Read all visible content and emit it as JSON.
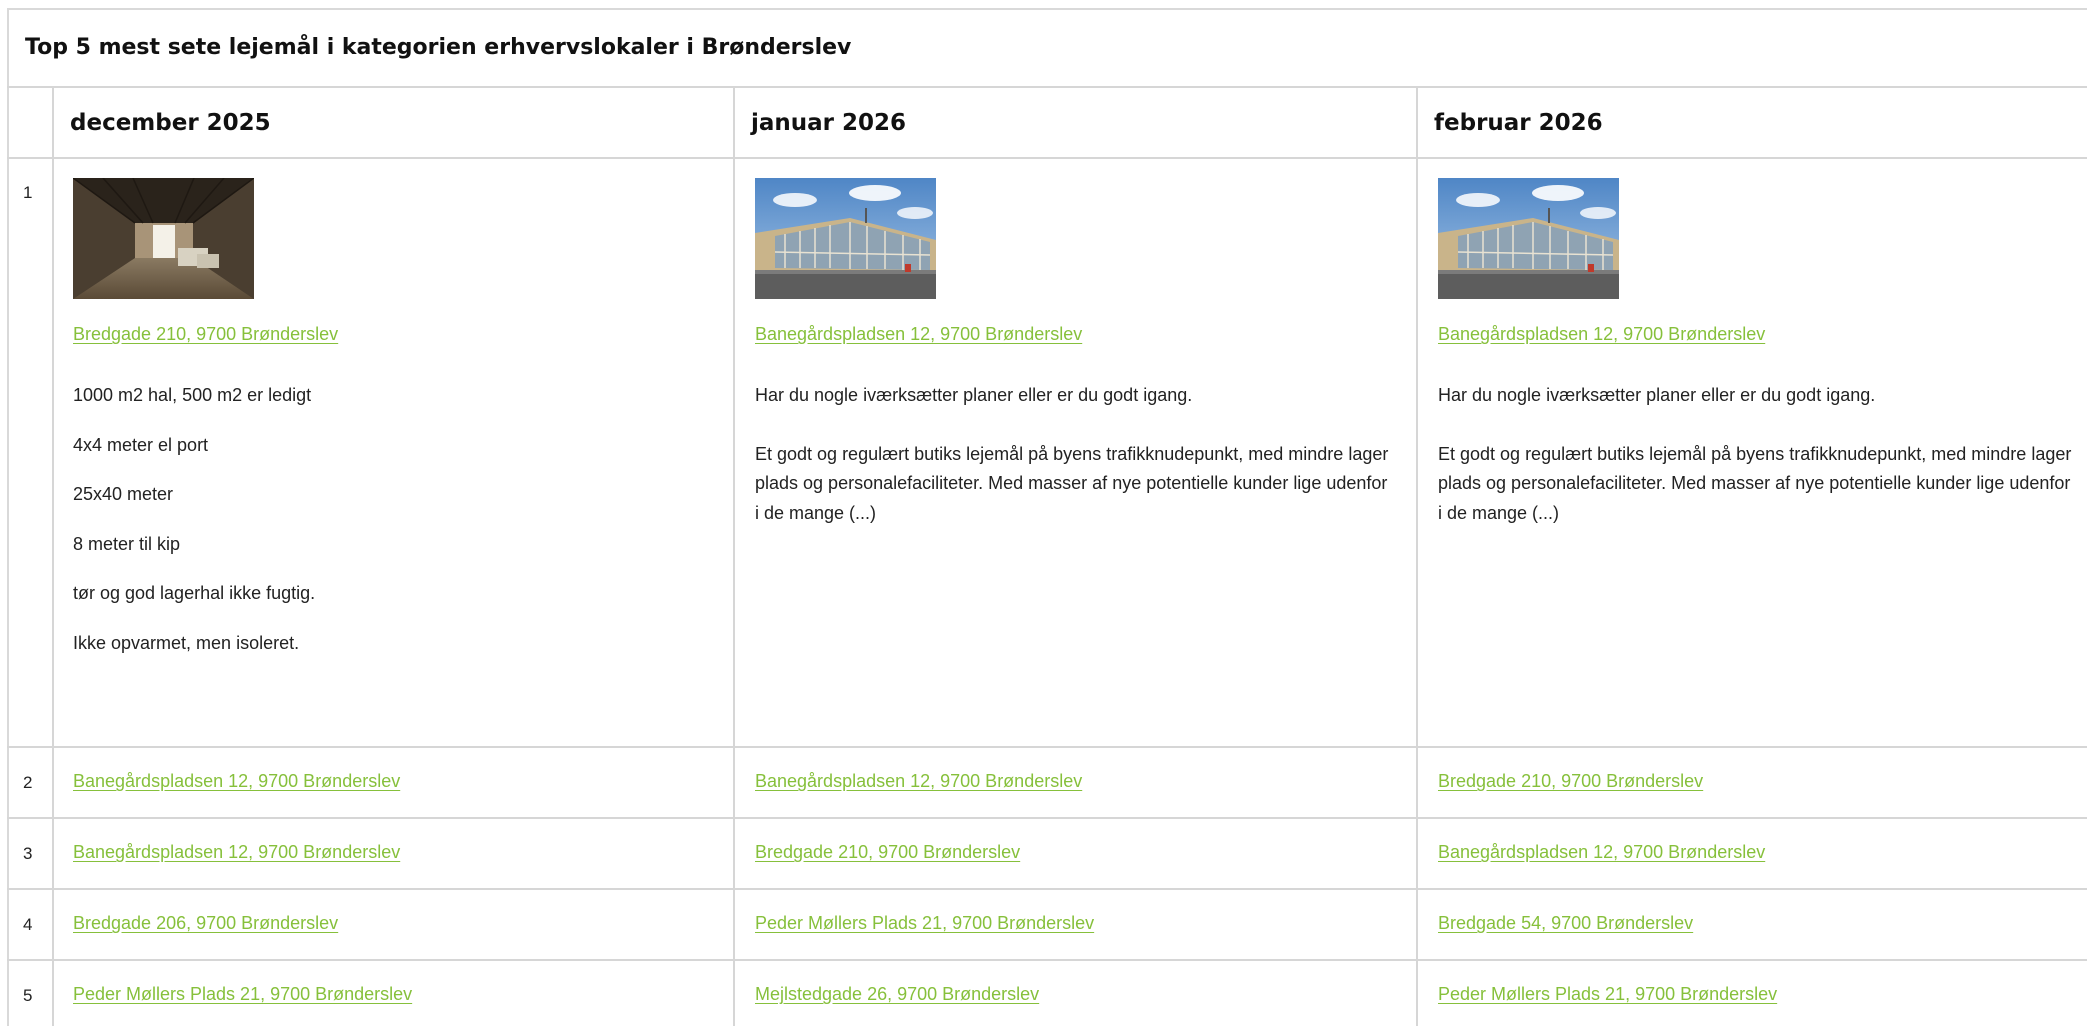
{
  "title": "Top 5 mest sete lejemål i kategorien erhvervslokaler i Brønderslev",
  "columns": [
    {
      "month": "december 2025"
    },
    {
      "month": "januar 2026"
    },
    {
      "month": "februar 2026"
    }
  ],
  "ranks": [
    "1",
    "2",
    "3",
    "4",
    "5"
  ],
  "top": [
    {
      "image": "warehouse-hall-photo",
      "address": "Bredgade 210, 9700 Brønderslev",
      "lines": [
        "1000 m2 hal, 500 m2 er ledigt",
        "4x4 meter el port",
        "25x40 meter",
        "8 meter til kip",
        "tør og god lagerhal ikke fugtig.",
        "Ikke opvarmet, men isoleret."
      ]
    },
    {
      "image": "station-building-photo",
      "address": "Banegårdspladsen 12, 9700 Brønderslev",
      "intro": "Har du nogle iværksætter planer eller er du godt igang.",
      "body": "Et godt og regulært butiks lejemål på byens trafikknudepunkt, med mindre lager plads og personalefaciliteter. Med masser af nye potentielle kunder lige udenfor i de mange (...)"
    },
    {
      "image": "station-building-photo",
      "address": "Banegårdspladsen 12, 9700 Brønderslev",
      "intro": "Har du nogle iværksætter planer eller er du godt igang.",
      "body": "Et godt og regulært butiks lejemål på byens trafikknudepunkt, med mindre lager plads og personalefaciliteter. Med masser af nye potentielle kunder lige udenfor i de mange (...)"
    }
  ],
  "rows": [
    [
      "Banegårdspladsen 12, 9700 Brønderslev",
      "Banegårdspladsen 12, 9700 Brønderslev",
      "Bredgade 210, 9700 Brønderslev"
    ],
    [
      "Banegårdspladsen 12, 9700 Brønderslev",
      "Bredgade 210, 9700 Brønderslev",
      "Banegårdspladsen 12, 9700 Brønderslev"
    ],
    [
      "Bredgade 206, 9700 Brønderslev",
      "Peder Møllers Plads 21, 9700 Brønderslev",
      "Bredgade 54, 9700 Brønderslev"
    ],
    [
      "Peder Møllers Plads 21, 9700 Brønderslev",
      "Mejlstedgade 26, 9700 Brønderslev",
      "Peder Møllers Plads 21, 9700 Brønderslev"
    ]
  ],
  "colors": {
    "link": "#86c03b",
    "grid": "#d6d6d6",
    "text": "#222222"
  }
}
